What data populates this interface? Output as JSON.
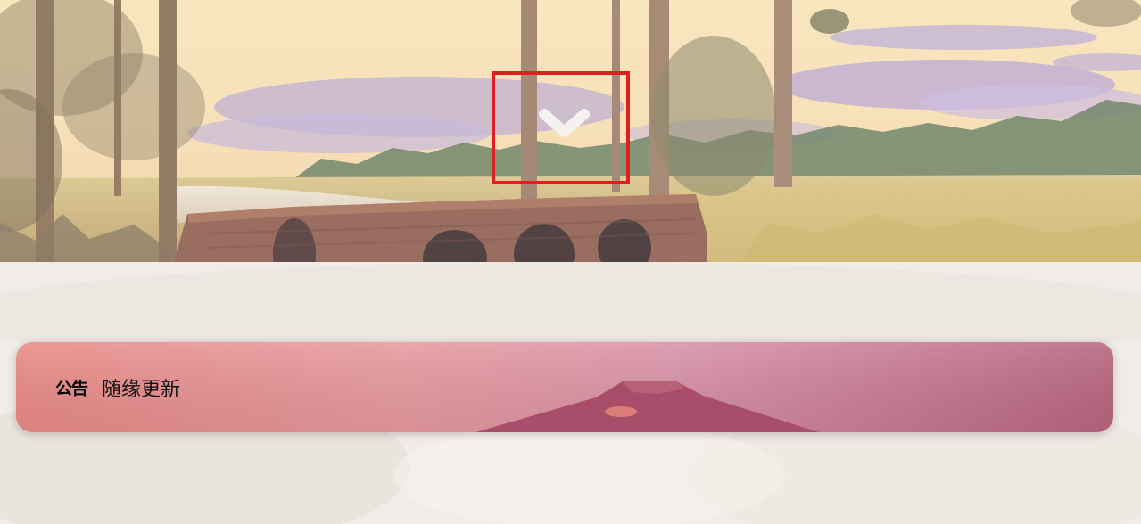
{
  "notice": {
    "tag": "公告",
    "text": "随缘更新"
  },
  "hero": {
    "scroll_icon": "chevron-down-icon",
    "highlight_color": "#e0201f"
  },
  "colors": {
    "notice_gradient_left": "#e98a86",
    "notice_gradient_right": "#b8657e",
    "page_background": "#efe9e2"
  }
}
